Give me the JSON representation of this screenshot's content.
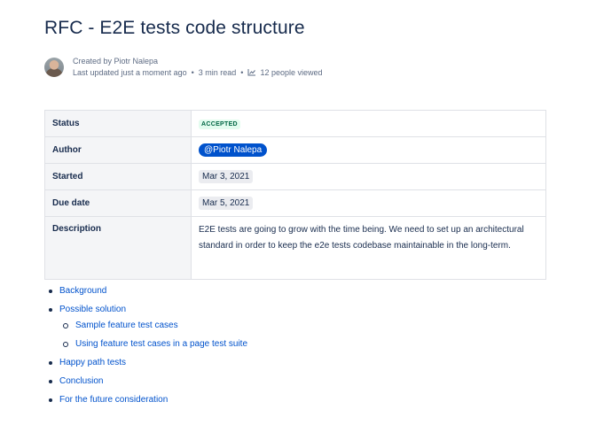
{
  "page": {
    "title": "RFC - E2E tests code structure"
  },
  "byline": {
    "created_by": "Created by Piotr Nalepa",
    "last_updated": "Last updated just a moment ago",
    "read_time": "3 min read",
    "views": "12 people viewed"
  },
  "properties": {
    "status_label": "Status",
    "status_value": "ACCEPTED",
    "author_label": "Author",
    "author_value": "@Piotr Nalepa",
    "started_label": "Started",
    "started_value": "Mar 3, 2021",
    "due_label": "Due date",
    "due_value": "Mar 5, 2021",
    "description_label": "Description",
    "description_value": "E2E tests are going to grow with the time being. We need to set up an architectural standard in order to keep the e2e tests codebase maintainable in the long-term."
  },
  "toc": {
    "items": [
      {
        "label": "Background"
      },
      {
        "label": "Possible solution",
        "children": [
          {
            "label": "Sample feature test cases"
          },
          {
            "label": "Using feature test cases in a page test suite"
          }
        ]
      },
      {
        "label": "Happy path tests"
      },
      {
        "label": "Conclusion"
      },
      {
        "label": "For the future consideration"
      }
    ]
  },
  "colors": {
    "link": "#0052cc",
    "status_bg": "#e3fcef",
    "status_text": "#006644",
    "mention_bg": "#0052cc"
  }
}
